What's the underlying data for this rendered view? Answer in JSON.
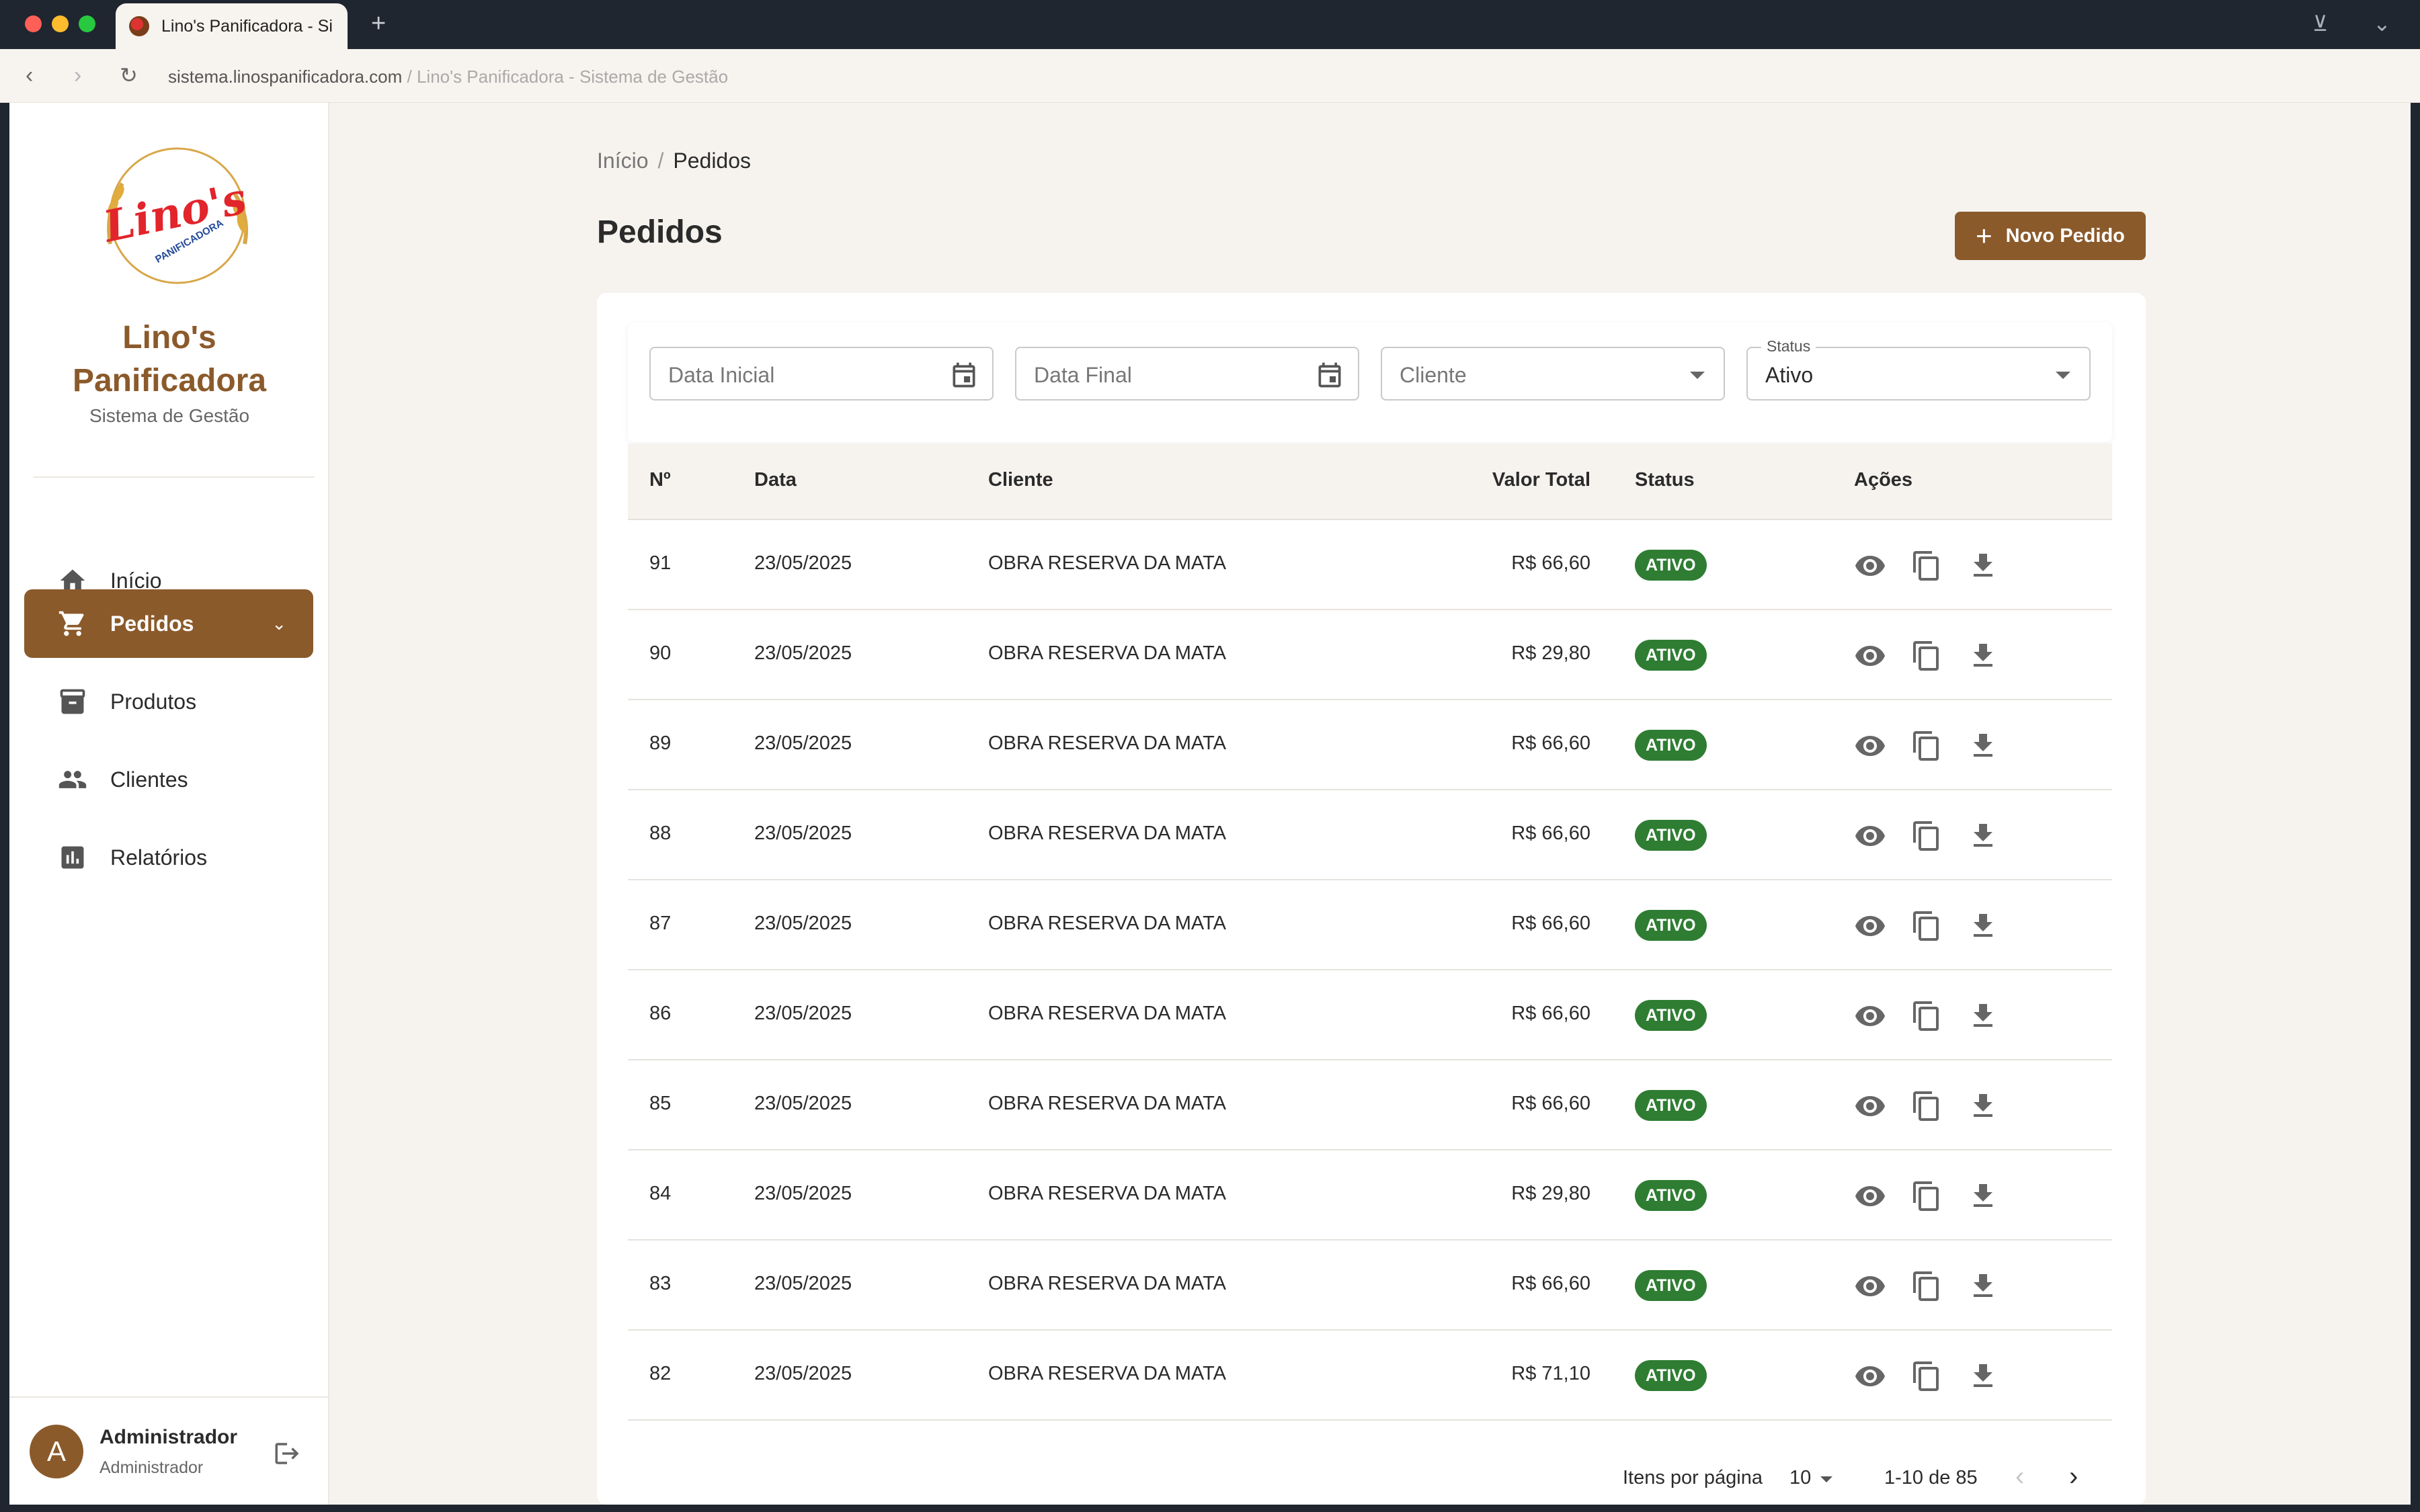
{
  "browser": {
    "tab_title": "Lino's Panificadora - Si",
    "new_tab": "+",
    "url_domain": "sistema.linospanificadora.com",
    "url_sep": " / ",
    "url_title": "Lino's Panificadora - Sistema de Gestão"
  },
  "sidebar": {
    "brand_line1": "Lino's",
    "brand_line2": "Panificadora",
    "subtitle": "Sistema de Gestão",
    "logo_text": "Lino's",
    "logo_sub": "PANIFICADORA",
    "items": [
      {
        "label": "Início",
        "icon": "home-icon"
      },
      {
        "label": "Pedidos",
        "icon": "cart-icon",
        "active": true
      },
      {
        "label": "Produtos",
        "icon": "archive-icon"
      },
      {
        "label": "Clientes",
        "icon": "people-icon"
      },
      {
        "label": "Relatórios",
        "icon": "chart-icon"
      }
    ],
    "user": {
      "initial": "A",
      "name": "Administrador",
      "role": "Administrador"
    }
  },
  "main": {
    "breadcrumb": {
      "home": "Início",
      "sep": "/",
      "current": "Pedidos"
    },
    "title": "Pedidos",
    "new_button": "Novo Pedido",
    "filters": {
      "start_date_placeholder": "Data Inicial",
      "end_date_placeholder": "Data Final",
      "client_placeholder": "Cliente",
      "status_label": "Status",
      "status_value": "Ativo"
    },
    "table": {
      "headers": {
        "num": "Nº",
        "date": "Data",
        "client": "Cliente",
        "total": "Valor Total",
        "status": "Status",
        "actions": "Ações"
      },
      "rows": [
        {
          "num": "91",
          "date": "23/05/2025",
          "client": "OBRA RESERVA DA MATA",
          "total": "R$ 66,60",
          "status": "ATIVO"
        },
        {
          "num": "90",
          "date": "23/05/2025",
          "client": "OBRA RESERVA DA MATA",
          "total": "R$ 29,80",
          "status": "ATIVO"
        },
        {
          "num": "89",
          "date": "23/05/2025",
          "client": "OBRA RESERVA DA MATA",
          "total": "R$ 66,60",
          "status": "ATIVO"
        },
        {
          "num": "88",
          "date": "23/05/2025",
          "client": "OBRA RESERVA DA MATA",
          "total": "R$ 66,60",
          "status": "ATIVO"
        },
        {
          "num": "87",
          "date": "23/05/2025",
          "client": "OBRA RESERVA DA MATA",
          "total": "R$ 66,60",
          "status": "ATIVO"
        },
        {
          "num": "86",
          "date": "23/05/2025",
          "client": "OBRA RESERVA DA MATA",
          "total": "R$ 66,60",
          "status": "ATIVO"
        },
        {
          "num": "85",
          "date": "23/05/2025",
          "client": "OBRA RESERVA DA MATA",
          "total": "R$ 66,60",
          "status": "ATIVO"
        },
        {
          "num": "84",
          "date": "23/05/2025",
          "client": "OBRA RESERVA DA MATA",
          "total": "R$ 29,80",
          "status": "ATIVO"
        },
        {
          "num": "83",
          "date": "23/05/2025",
          "client": "OBRA RESERVA DA MATA",
          "total": "R$ 66,60",
          "status": "ATIVO"
        },
        {
          "num": "82",
          "date": "23/05/2025",
          "client": "OBRA RESERVA DA MATA",
          "total": "R$ 71,10",
          "status": "ATIVO"
        }
      ]
    },
    "pagination": {
      "label": "Itens por página",
      "page_size": "10",
      "range": "1-10 de 85"
    }
  },
  "colors": {
    "brand": "#8b5a2b",
    "active_badge": "#2e7d32",
    "background": "#f6f3ef"
  }
}
